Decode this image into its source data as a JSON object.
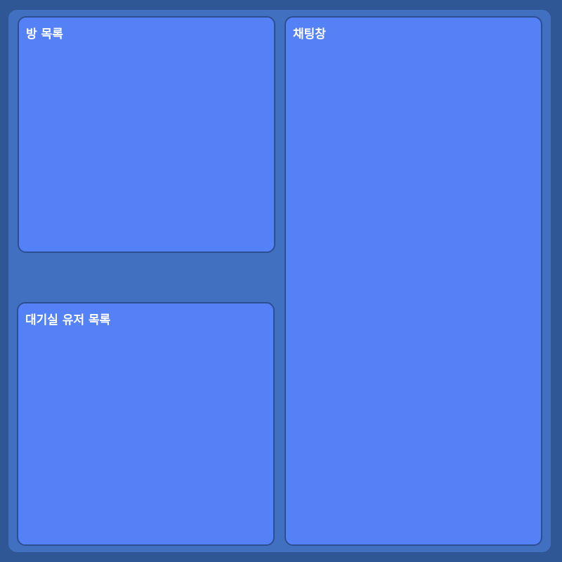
{
  "panels": {
    "room_list": {
      "title": "방 목록"
    },
    "lobby_users": {
      "title": "대기실 유저 목록"
    },
    "chat": {
      "title": "채팅창"
    }
  },
  "colors": {
    "background": "#2f5695",
    "frame": "#4270c0",
    "panel": "#5581f7",
    "panel_border": "#2c4f92",
    "title_text": "#ffffff"
  }
}
